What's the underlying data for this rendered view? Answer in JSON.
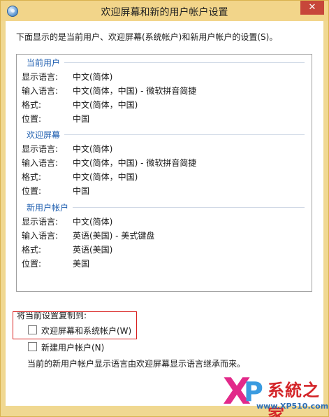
{
  "window": {
    "title": "欢迎屏幕和新的用户帐户设置",
    "close_label": "✕"
  },
  "intro": "下面显示的是当前用户、欢迎屏幕(系统帐户)和新用户帐户的设置(S)。",
  "groups": [
    {
      "title": "当前用户",
      "rows": [
        {
          "label": "显示语言:",
          "value": "中文(简体)"
        },
        {
          "label": "输入语言:",
          "value": "中文(简体，中国) - 微软拼音简捷"
        },
        {
          "label": "格式:",
          "value": "中文(简体，中国)"
        },
        {
          "label": "位置:",
          "value": "中国"
        }
      ]
    },
    {
      "title": "欢迎屏幕",
      "rows": [
        {
          "label": "显示语言:",
          "value": "中文(简体)"
        },
        {
          "label": "输入语言:",
          "value": "中文(简体，中国) - 微软拼音简捷"
        },
        {
          "label": "格式:",
          "value": "中文(简体，中国)"
        },
        {
          "label": "位置:",
          "value": "中国"
        }
      ]
    },
    {
      "title": "新用户帐户",
      "rows": [
        {
          "label": "显示语言:",
          "value": "中文(简体)"
        },
        {
          "label": "输入语言:",
          "value": "英语(美国) - 美式键盘"
        },
        {
          "label": "格式:",
          "value": "英语(美国)"
        },
        {
          "label": "位置:",
          "value": "美国"
        }
      ]
    }
  ],
  "copy_section": {
    "label": "将当前设置复制到:",
    "options": [
      {
        "label": "欢迎屏幕和系统帐户(W)",
        "checked": false
      },
      {
        "label": "新建用户帐户(N)",
        "checked": false
      }
    ],
    "note": "当前的新用户帐户显示语言由欢迎屏幕显示语言继承而来。"
  },
  "watermark": {
    "x": "X",
    "p": "P",
    "brand": "系統之家",
    "url": "www.XP510.com"
  },
  "colors": {
    "titlebar": "#f2d58a",
    "group_title": "#1f5fb0",
    "highlight": "#d8201f",
    "close": "#c7463a"
  }
}
